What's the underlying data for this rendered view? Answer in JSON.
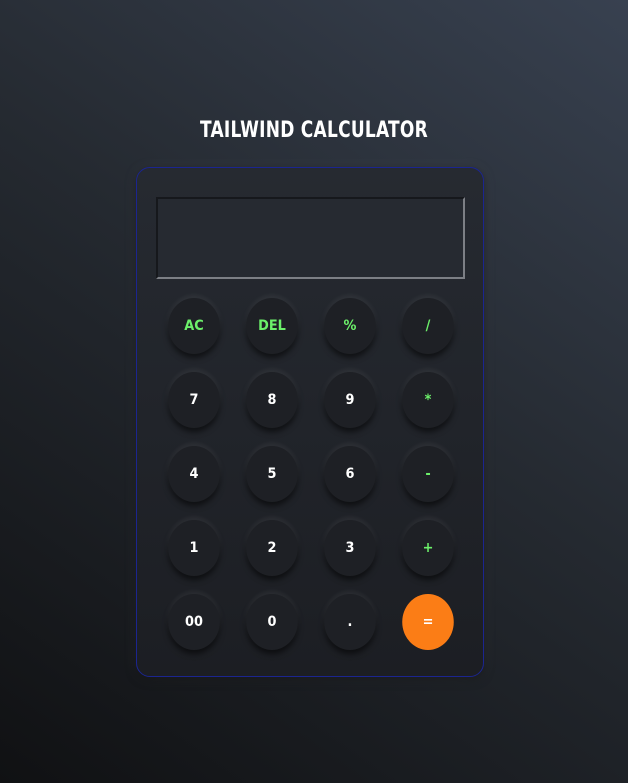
{
  "app": {
    "title": "TAILWIND CALCULATOR"
  },
  "display": {
    "value": ""
  },
  "keys": [
    {
      "label": "AC",
      "name": "all-clear-button",
      "style": "green"
    },
    {
      "label": "DEL",
      "name": "delete-button",
      "style": "green"
    },
    {
      "label": "%",
      "name": "percent-button",
      "style": "green"
    },
    {
      "label": "/",
      "name": "divide-button",
      "style": "green"
    },
    {
      "label": "7",
      "name": "digit-7-button",
      "style": "white"
    },
    {
      "label": "8",
      "name": "digit-8-button",
      "style": "white"
    },
    {
      "label": "9",
      "name": "digit-9-button",
      "style": "white"
    },
    {
      "label": "*",
      "name": "multiply-button",
      "style": "green"
    },
    {
      "label": "4",
      "name": "digit-4-button",
      "style": "white"
    },
    {
      "label": "5",
      "name": "digit-5-button",
      "style": "white"
    },
    {
      "label": "6",
      "name": "digit-6-button",
      "style": "white"
    },
    {
      "label": "-",
      "name": "subtract-button",
      "style": "green"
    },
    {
      "label": "1",
      "name": "digit-1-button",
      "style": "white"
    },
    {
      "label": "2",
      "name": "digit-2-button",
      "style": "white"
    },
    {
      "label": "3",
      "name": "digit-3-button",
      "style": "white"
    },
    {
      "label": "+",
      "name": "add-button",
      "style": "green"
    },
    {
      "label": "00",
      "name": "double-zero-button",
      "style": "white"
    },
    {
      "label": "0",
      "name": "digit-0-button",
      "style": "white"
    },
    {
      "label": ".",
      "name": "decimal-point-button",
      "style": "white"
    },
    {
      "label": "=",
      "name": "equals-button",
      "style": "equals"
    }
  ],
  "colors": {
    "operator_text": "#6cf06a",
    "equals_accent": "#fb7d16",
    "border_accent": "#1b2590"
  }
}
